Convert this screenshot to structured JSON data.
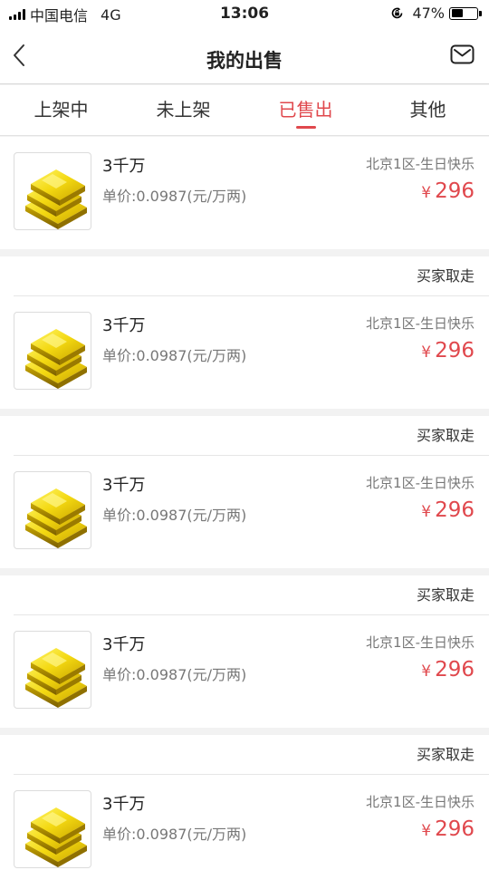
{
  "status_bar": {
    "carrier": "中国电信",
    "network": "4G",
    "time": "13:06",
    "battery": "47%",
    "battery_level": 0.47
  },
  "header": {
    "title": "我的出售"
  },
  "tabs": [
    {
      "label": "上架中"
    },
    {
      "label": "未上架"
    },
    {
      "label": "已售出"
    },
    {
      "label": "其他"
    }
  ],
  "active_tab": "已售出",
  "accent_color": "#e0484d",
  "icons": [
    "back-arrow-icon",
    "mail-icon",
    "signal-icon",
    "orientation-lock-icon",
    "battery-icon",
    "gold-bars-icon"
  ],
  "orders": [
    {
      "status": "",
      "name": "3千万",
      "unit_price": "单价:0.0987(元/万两)",
      "server": "北京1区-生日快乐",
      "currency": "¥",
      "price": "296"
    },
    {
      "status": "买家取走",
      "name": "3千万",
      "unit_price": "单价:0.0987(元/万两)",
      "server": "北京1区-生日快乐",
      "currency": "¥",
      "price": "296"
    },
    {
      "status": "买家取走",
      "name": "3千万",
      "unit_price": "单价:0.0987(元/万两)",
      "server": "北京1区-生日快乐",
      "currency": "¥",
      "price": "296"
    },
    {
      "status": "买家取走",
      "name": "3千万",
      "unit_price": "单价:0.0987(元/万两)",
      "server": "北京1区-生日快乐",
      "currency": "¥",
      "price": "296"
    },
    {
      "status": "买家取走",
      "name": "3千万",
      "unit_price": "单价:0.0987(元/万两)",
      "server": "北京1区-生日快乐",
      "currency": "¥",
      "price": "296"
    }
  ]
}
